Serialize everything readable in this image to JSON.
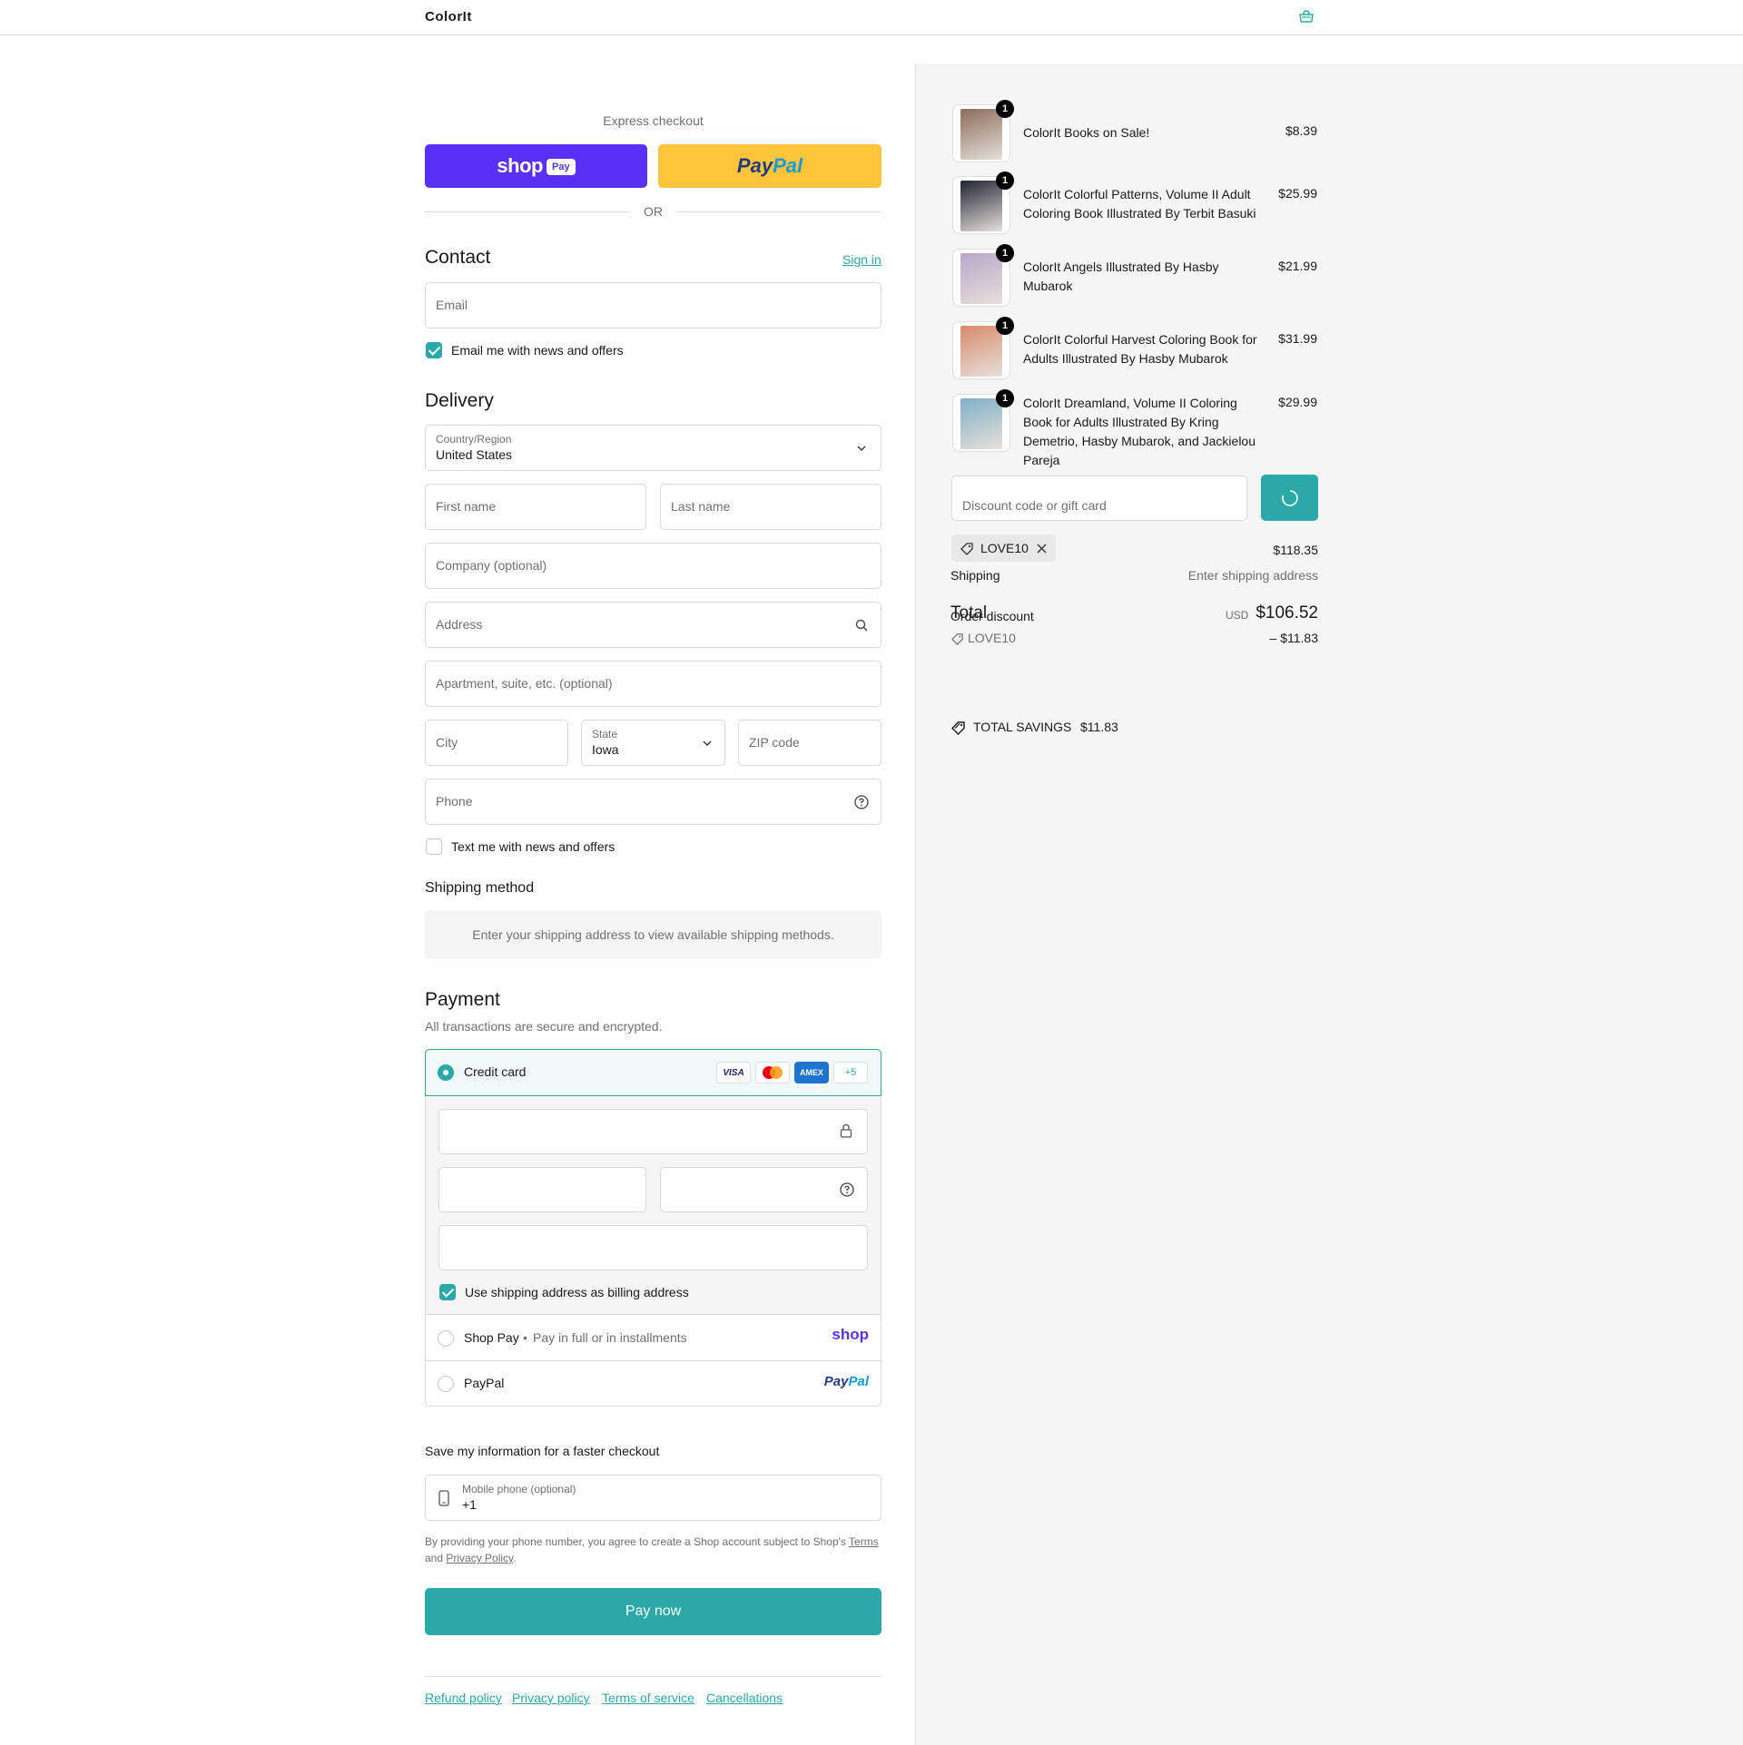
{
  "header": {
    "logo": "ColorIt",
    "cart_icon": "bag-icon"
  },
  "express": {
    "title": "Express checkout",
    "shoppay_logo": "shop",
    "shoppay_badge": "Pay",
    "paypal_logo_a": "Pay",
    "paypal_logo_b": "Pal",
    "or": "OR"
  },
  "contact": {
    "title": "Contact",
    "sign_in": "Sign in",
    "email_placeholder": "Email",
    "email_offers": "Email me with news and offers"
  },
  "delivery": {
    "title": "Delivery",
    "country_label": "Country/Region",
    "country_value": "United States",
    "first_name": "First name",
    "last_name": "Last name",
    "company": "Company (optional)",
    "address": "Address",
    "apartment": "Apartment, suite, etc. (optional)",
    "city": "City",
    "state_label": "State",
    "state_value": "Iowa",
    "zip": "ZIP code",
    "phone": "Phone",
    "text_offers": "Text me with news and offers"
  },
  "shipping_method": {
    "title": "Shipping method",
    "message": "Enter your shipping address to view available shipping methods."
  },
  "payment": {
    "title": "Payment",
    "subtitle": "All transactions are secure and encrypted.",
    "credit_card": "Credit card",
    "cards": [
      "VISA",
      "",
      "AMEX",
      "+5"
    ],
    "billing_same": "Use shipping address as billing address",
    "shop_pay": "Shop Pay",
    "shop_pay_sep": "•",
    "shop_pay_desc": "Pay in full or in installments",
    "shop_logo": "shop",
    "paypal": "PayPal",
    "paypal_logo_a": "Pay",
    "paypal_logo_b": "Pal"
  },
  "save_info": {
    "title": "Save my information for a faster checkout",
    "mobile_label": "Mobile phone (optional)",
    "mobile_value": "+1",
    "legal_1": "By providing your phone number, you agree to create a Shop account subject to Shop's",
    "terms": "Terms",
    "legal_and": "and",
    "privacy": "Privacy Policy",
    "legal_end": "."
  },
  "pay_now": "Pay now",
  "footer_links": [
    "Refund policy",
    "Privacy policy",
    "Terms of service",
    "Cancellations"
  ],
  "order": {
    "items": [
      {
        "name": "ColorIt Books on Sale!",
        "price": "$8.39",
        "qty": "1",
        "tint": "#8a6d5a"
      },
      {
        "name": "ColorIt Colorful Patterns, Volume II Adult Coloring Book Illustrated By Terbit Basuki",
        "price": "$25.99",
        "qty": "1",
        "tint": "#1f2433"
      },
      {
        "name": "ColorIt Angels Illustrated By Hasby Mubarok",
        "price": "$21.99",
        "qty": "1",
        "tint": "#b9a6c9"
      },
      {
        "name": "ColorIt Colorful Harvest Coloring Book for Adults Illustrated By Hasby Mubarok",
        "price": "$31.99",
        "qty": "1",
        "tint": "#d98a6c"
      },
      {
        "name": "ColorIt Dreamland, Volume II Coloring Book for Adults Illustrated By Kring Demetrio, Hasby Mubarok, and Jackielou Pareja",
        "price": "$29.99",
        "qty": "1",
        "tint": "#7fb0c8"
      }
    ],
    "discount_placeholder": "Discount code or gift card",
    "applied_code": "LOVE10",
    "subtotal": "$118.35",
    "shipping_label": "Shipping",
    "shipping_value": "Enter shipping address",
    "total_label": "Total",
    "order_discount_label": "Order discount",
    "currency": "USD",
    "total": "$106.52",
    "discount_code": "LOVE10",
    "discount_amount": "– $11.83",
    "savings_label": "TOTAL SAVINGS",
    "savings_value": "$11.83"
  },
  "colors": {
    "accent": "#2ba8a8",
    "shoppay": "#5a31f4",
    "paypal": "#ffc439"
  }
}
